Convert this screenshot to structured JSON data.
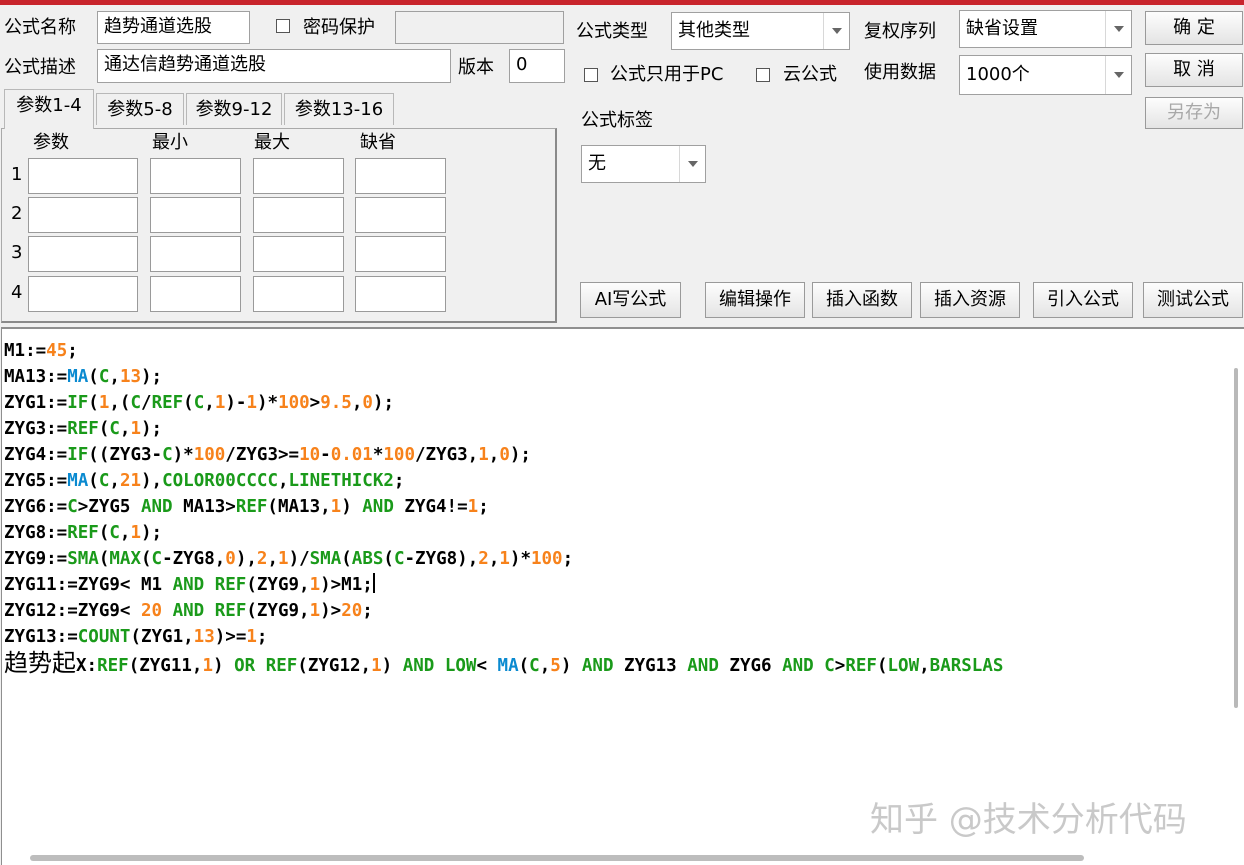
{
  "colors": {
    "text": "#000000",
    "number": "#f7821b",
    "function": "#1a9a1a",
    "keyword": "#0a8ad0",
    "accent_bar": "#c8242c"
  },
  "header": {
    "name_label": "公式名称",
    "name_value": "趋势通道选股",
    "password_label": "密码保护",
    "desc_label": "公式描述",
    "desc_value": "通达信趋势通道选股",
    "version_label": "版本",
    "version_value": "0",
    "type_label": "公式类型",
    "type_value": "其他类型",
    "fq_label": "复权序列",
    "fq_value": "缺省设置",
    "pc_only_label": "公式只用于PC",
    "cloud_label": "云公式",
    "usedata_label": "使用数据",
    "usedata_value": "1000个",
    "tag_label": "公式标签",
    "tag_value": "无"
  },
  "buttons": {
    "ok": "确  定",
    "cancel": "取  消",
    "save_as": "另存为",
    "ai": "AI写公式",
    "edit": "编辑操作",
    "insert_func": "插入函数",
    "insert_res": "插入资源",
    "import": "引入公式",
    "test": "测试公式"
  },
  "tabs": [
    "参数1-4",
    "参数5-8",
    "参数9-12",
    "参数13-16"
  ],
  "params": {
    "headers": [
      "参数",
      "最小",
      "最大",
      "缺省"
    ],
    "rows": [
      "1",
      "2",
      "3",
      "4"
    ]
  },
  "code_lines": [
    [
      [
        "M1:=",
        "t"
      ],
      [
        "45",
        "n"
      ],
      [
        ";",
        "t"
      ]
    ],
    [
      [
        "MA13:=",
        "t"
      ],
      [
        "MA",
        "k"
      ],
      [
        "(",
        "t"
      ],
      [
        "C",
        "f"
      ],
      [
        ",",
        "t"
      ],
      [
        "13",
        "n"
      ],
      [
        ");",
        "t"
      ]
    ],
    [
      [
        "ZYG1:=",
        "t"
      ],
      [
        "IF",
        "f"
      ],
      [
        "(",
        "t"
      ],
      [
        "1",
        "n"
      ],
      [
        ",(",
        "t"
      ],
      [
        "C",
        "f"
      ],
      [
        "/",
        "t"
      ],
      [
        "REF",
        "f"
      ],
      [
        "(",
        "t"
      ],
      [
        "C",
        "f"
      ],
      [
        ",",
        "t"
      ],
      [
        "1",
        "n"
      ],
      [
        ")-",
        "t"
      ],
      [
        "1",
        "n"
      ],
      [
        ")*",
        "t"
      ],
      [
        "100",
        "n"
      ],
      [
        ">",
        "t"
      ],
      [
        "9.5",
        "n"
      ],
      [
        ",",
        "t"
      ],
      [
        "0",
        "n"
      ],
      [
        ");",
        "t"
      ]
    ],
    [
      [
        "ZYG3:=",
        "t"
      ],
      [
        "REF",
        "f"
      ],
      [
        "(",
        "t"
      ],
      [
        "C",
        "f"
      ],
      [
        ",",
        "t"
      ],
      [
        "1",
        "n"
      ],
      [
        ");",
        "t"
      ]
    ],
    [
      [
        "ZYG4:=",
        "t"
      ],
      [
        "IF",
        "f"
      ],
      [
        "((ZYG3-",
        "t"
      ],
      [
        "C",
        "f"
      ],
      [
        ")*",
        "t"
      ],
      [
        "100",
        "n"
      ],
      [
        "/ZYG3>=",
        "t"
      ],
      [
        "10",
        "n"
      ],
      [
        "-",
        "t"
      ],
      [
        "0.01",
        "n"
      ],
      [
        "*",
        "t"
      ],
      [
        "100",
        "n"
      ],
      [
        "/ZYG3,",
        "t"
      ],
      [
        "1",
        "n"
      ],
      [
        ",",
        "t"
      ],
      [
        "0",
        "n"
      ],
      [
        ");",
        "t"
      ]
    ],
    [
      [
        "ZYG5:=",
        "t"
      ],
      [
        "MA",
        "k"
      ],
      [
        "(",
        "t"
      ],
      [
        "C",
        "f"
      ],
      [
        ",",
        "t"
      ],
      [
        "21",
        "n"
      ],
      [
        "),",
        "t"
      ],
      [
        "COLOR00CCCC",
        "f"
      ],
      [
        ",",
        "t"
      ],
      [
        "LINETHICK2",
        "f"
      ],
      [
        ";",
        "t"
      ]
    ],
    [
      [
        "ZYG6:=",
        "t"
      ],
      [
        "C",
        "f"
      ],
      [
        ">ZYG5 ",
        "t"
      ],
      [
        "AND",
        "f"
      ],
      [
        " MA13>",
        "t"
      ],
      [
        "REF",
        "f"
      ],
      [
        "(MA13,",
        "t"
      ],
      [
        "1",
        "n"
      ],
      [
        ") ",
        "t"
      ],
      [
        "AND",
        "f"
      ],
      [
        " ZYG4!=",
        "t"
      ],
      [
        "1",
        "n"
      ],
      [
        ";",
        "t"
      ]
    ],
    [
      [
        "ZYG8:=",
        "t"
      ],
      [
        "REF",
        "f"
      ],
      [
        "(",
        "t"
      ],
      [
        "C",
        "f"
      ],
      [
        ",",
        "t"
      ],
      [
        "1",
        "n"
      ],
      [
        ");",
        "t"
      ]
    ],
    [
      [
        "ZYG9:=",
        "t"
      ],
      [
        "SMA",
        "f"
      ],
      [
        "(",
        "t"
      ],
      [
        "MAX",
        "f"
      ],
      [
        "(",
        "t"
      ],
      [
        "C",
        "f"
      ],
      [
        "-ZYG8,",
        "t"
      ],
      [
        "0",
        "n"
      ],
      [
        "),",
        "t"
      ],
      [
        "2",
        "n"
      ],
      [
        ",",
        "t"
      ],
      [
        "1",
        "n"
      ],
      [
        ")/",
        "t"
      ],
      [
        "SMA",
        "f"
      ],
      [
        "(",
        "t"
      ],
      [
        "ABS",
        "f"
      ],
      [
        "(",
        "t"
      ],
      [
        "C",
        "f"
      ],
      [
        "-ZYG8),",
        "t"
      ],
      [
        "2",
        "n"
      ],
      [
        ",",
        "t"
      ],
      [
        "1",
        "n"
      ],
      [
        ")*",
        "t"
      ],
      [
        "100",
        "n"
      ],
      [
        ";",
        "t"
      ]
    ],
    [
      [
        "ZYG11:=ZYG9< M1 ",
        "t"
      ],
      [
        "AND",
        "f"
      ],
      [
        " ",
        "t"
      ],
      [
        "REF",
        "f"
      ],
      [
        "(ZYG9,",
        "t"
      ],
      [
        "1",
        "n"
      ],
      [
        ")>M1;",
        "t"
      ],
      [
        "",
        "caret"
      ]
    ],
    [
      [
        "ZYG12:=ZYG9< ",
        "t"
      ],
      [
        "20",
        "n"
      ],
      [
        " ",
        "t"
      ],
      [
        "AND",
        "f"
      ],
      [
        " ",
        "t"
      ],
      [
        "REF",
        "f"
      ],
      [
        "(ZYG9,",
        "t"
      ],
      [
        "1",
        "n"
      ],
      [
        ")>",
        "t"
      ],
      [
        "20",
        "n"
      ],
      [
        ";",
        "t"
      ]
    ],
    [
      [
        "ZYG13:=",
        "t"
      ],
      [
        "COUNT",
        "f"
      ],
      [
        "(ZYG1,",
        "t"
      ],
      [
        "13",
        "n"
      ],
      [
        ")>=",
        "t"
      ],
      [
        "1",
        "n"
      ],
      [
        ";",
        "t"
      ]
    ],
    [
      [
        "趋势起",
        "cjk"
      ],
      [
        "X:",
        "t"
      ],
      [
        "REF",
        "f"
      ],
      [
        "(ZYG11,",
        "t"
      ],
      [
        "1",
        "n"
      ],
      [
        ") ",
        "t"
      ],
      [
        "OR",
        "f"
      ],
      [
        " ",
        "t"
      ],
      [
        "REF",
        "f"
      ],
      [
        "(ZYG12,",
        "t"
      ],
      [
        "1",
        "n"
      ],
      [
        ") ",
        "t"
      ],
      [
        "AND",
        "f"
      ],
      [
        " ",
        "t"
      ],
      [
        "LOW",
        "f"
      ],
      [
        "< ",
        "t"
      ],
      [
        "MA",
        "k"
      ],
      [
        "(",
        "t"
      ],
      [
        "C",
        "f"
      ],
      [
        ",",
        "t"
      ],
      [
        "5",
        "n"
      ],
      [
        ") ",
        "t"
      ],
      [
        "AND",
        "f"
      ],
      [
        " ZYG13 ",
        "t"
      ],
      [
        "AND",
        "f"
      ],
      [
        " ZYG6 ",
        "t"
      ],
      [
        "AND",
        "f"
      ],
      [
        " ",
        "t"
      ],
      [
        "C",
        "f"
      ],
      [
        ">",
        "t"
      ],
      [
        "REF",
        "f"
      ],
      [
        "(",
        "t"
      ],
      [
        "LOW",
        "f"
      ],
      [
        ",",
        "t"
      ],
      [
        "BARSLAS",
        "f"
      ]
    ]
  ],
  "watermark": "知乎 @技术分析代码"
}
